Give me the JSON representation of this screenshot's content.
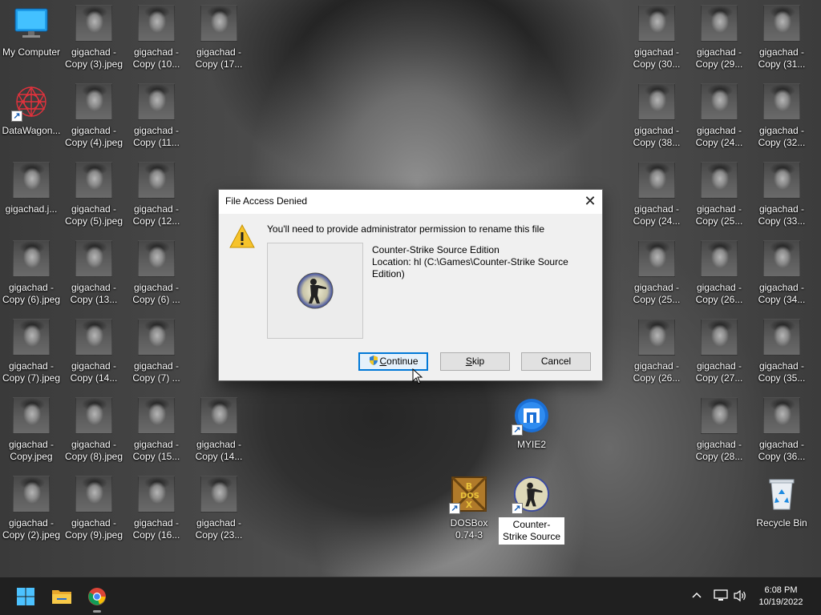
{
  "desktop": {
    "icons": [
      {
        "label": "My Computer",
        "type": "computer"
      },
      {
        "label": "DataWagon...",
        "type": "datawagon",
        "shortcut": true
      },
      {
        "label": "gigachad.j...",
        "type": "image"
      },
      {
        "label": "gigachad -\nCopy (6).jpeg",
        "type": "image"
      },
      {
        "label": "gigachad -\nCopy (7).jpeg",
        "type": "image"
      },
      {
        "label": "gigachad -\nCopy.jpeg",
        "type": "image"
      },
      {
        "label": "gigachad -\nCopy (2).jpeg",
        "type": "image"
      },
      {
        "label": "gigachad -\nCopy (3).jpeg",
        "type": "image"
      },
      {
        "label": "gigachad -\nCopy (4).jpeg",
        "type": "image"
      },
      {
        "label": "gigachad -\nCopy (5).jpeg",
        "type": "image"
      },
      {
        "label": "gigachad -\nCopy (13...",
        "type": "image"
      },
      {
        "label": "gigachad -\nCopy (14...",
        "type": "image"
      },
      {
        "label": "gigachad -\nCopy (8).jpeg",
        "type": "image"
      },
      {
        "label": "gigachad -\nCopy (9).jpeg",
        "type": "image"
      },
      {
        "label": "gigachad -\nCopy (10...",
        "type": "image"
      },
      {
        "label": "gigachad -\nCopy (11...",
        "type": "image"
      },
      {
        "label": "gigachad -\nCopy (12...",
        "type": "image"
      },
      {
        "label": "gigachad -\nCopy (6) ...",
        "type": "image"
      },
      {
        "label": "gigachad -\nCopy (7) ...",
        "type": "image"
      },
      {
        "label": "gigachad -\nCopy (15...",
        "type": "image"
      },
      {
        "label": "gigachad -\nCopy (16...",
        "type": "image"
      },
      {
        "label": "gigachad -\nCopy (17...",
        "type": "image"
      },
      {
        "label": "gigachad -\nCopy (14...",
        "type": "image"
      },
      {
        "label": "gigachad -\nCopy (23...",
        "type": "image"
      },
      {
        "label": "DOSBox\n0.74-3",
        "type": "dosbox",
        "shortcut": true
      },
      {
        "label": "MYIE2",
        "type": "myie",
        "shortcut": true
      },
      {
        "label": "Counter-\nStrike Source",
        "type": "css",
        "shortcut": true,
        "selected": true
      },
      {
        "label": "gigachad -\nCopy (30...",
        "type": "image"
      },
      {
        "label": "gigachad -\nCopy (38...",
        "type": "image"
      },
      {
        "label": "gigachad -\nCopy (24...",
        "type": "image"
      },
      {
        "label": "gigachad -\nCopy (25...",
        "type": "image"
      },
      {
        "label": "gigachad -\nCopy (26...",
        "type": "image"
      },
      {
        "label": "gigachad -\nCopy (29...",
        "type": "image"
      },
      {
        "label": "gigachad -\nCopy (24...",
        "type": "image"
      },
      {
        "label": "gigachad -\nCopy (25...",
        "type": "image"
      },
      {
        "label": "gigachad -\nCopy (26...",
        "type": "image"
      },
      {
        "label": "gigachad -\nCopy (27...",
        "type": "image"
      },
      {
        "label": "gigachad -\nCopy (28...",
        "type": "image"
      },
      {
        "label": "gigachad -\nCopy (31...",
        "type": "image"
      },
      {
        "label": "gigachad -\nCopy (32...",
        "type": "image"
      },
      {
        "label": "gigachad -\nCopy (33...",
        "type": "image"
      },
      {
        "label": "gigachad -\nCopy (34...",
        "type": "image"
      },
      {
        "label": "gigachad -\nCopy (35...",
        "type": "image"
      },
      {
        "label": "gigachad -\nCopy (36...",
        "type": "image"
      },
      {
        "label": "Recycle Bin",
        "type": "recycle"
      }
    ]
  },
  "dialog": {
    "title": "File Access Denied",
    "close_glyph": "✕",
    "message": "You'll need to provide administrator permission to rename this file",
    "file_name": "Counter-Strike Source Edition",
    "location": "Location: hl (C:\\Games\\Counter-Strike Source Edition)",
    "buttons": {
      "continue": {
        "prefix": "",
        "mnemonic": "C",
        "rest": "ontinue"
      },
      "skip": {
        "prefix": "",
        "mnemonic": "S",
        "rest": "kip"
      },
      "cancel": {
        "label": "Cancel"
      }
    }
  },
  "taskbar": {
    "pinned": [
      "start-icon",
      "file-explorer-icon",
      "chrome-icon"
    ],
    "tray": [
      "chevron-up-icon",
      "network-icon",
      "volume-icon"
    ],
    "time": "6:08 PM",
    "date": "10/19/2022"
  },
  "colors": {
    "accent": "#0078d7",
    "taskbar": "#202020",
    "dialog_bg": "#f0f0f0"
  }
}
